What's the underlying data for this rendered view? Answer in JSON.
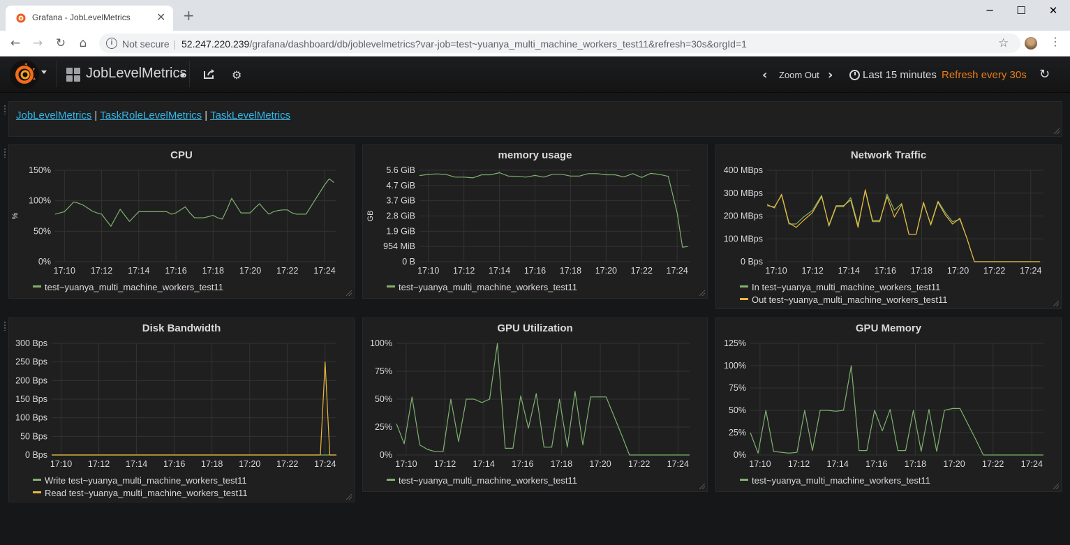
{
  "browser": {
    "tab_title": "Grafana - JobLevelMetrics",
    "tab_close": "✕",
    "new_tab": "+",
    "window": {
      "minimize": "─",
      "maximize": "☐",
      "close": "✕"
    },
    "back": "←",
    "forward": "→",
    "reload": "↻",
    "home": "⌂",
    "security_label": "Not secure",
    "url_host": "52.247.220.239",
    "url_rest": "/grafana/dashboard/db/joblevelmetrics?var-job=test~yuanya_multi_machine_workers_test11&refresh=30s&orgId=1",
    "star": "☆",
    "menu": "⋮"
  },
  "navbar": {
    "dashboard_title": "JobLevelMetrics",
    "share_icon": "share-icon",
    "settings_icon": "gear-icon",
    "zoom_out": "Zoom Out",
    "zoom_prev": "‹",
    "zoom_next": "›",
    "time_range": "Last 15 minutes",
    "refresh": "Refresh every 30s",
    "refresh_icon": "↻",
    "accent_color": "#eb7b18"
  },
  "links": {
    "items": [
      "JobLevelMetrics",
      "TaskRoleLevelMetrics",
      "TaskLevelMetrics"
    ],
    "separator": "|"
  },
  "panels": [
    {
      "title": "CPU",
      "legend": [
        {
          "label": "test~yuanya_multi_machine_workers_test11",
          "color": "#7eb26d"
        }
      ]
    },
    {
      "title": "memory usage",
      "legend": [
        {
          "label": "test~yuanya_multi_machine_workers_test11",
          "color": "#7eb26d"
        }
      ]
    },
    {
      "title": "Network Traffic",
      "legend": [
        {
          "label": "In test~yuanya_multi_machine_workers_test11",
          "color": "#7eb26d"
        },
        {
          "label": "Out test~yuanya_multi_machine_workers_test11",
          "color": "#eab839"
        }
      ]
    },
    {
      "title": "Disk Bandwidth",
      "legend": [
        {
          "label": "Write test~yuanya_multi_machine_workers_test11",
          "color": "#7eb26d"
        },
        {
          "label": "Read test~yuanya_multi_machine_workers_test11",
          "color": "#eab839"
        }
      ]
    },
    {
      "title": "GPU Utilization",
      "legend": [
        {
          "label": "test~yuanya_multi_machine_workers_test11",
          "color": "#7eb26d"
        }
      ]
    },
    {
      "title": "GPU Memory",
      "legend": [
        {
          "label": "test~yuanya_multi_machine_workers_test11",
          "color": "#7eb26d"
        }
      ]
    }
  ],
  "chart_data": [
    {
      "type": "line",
      "title": "CPU",
      "ylabel": "%",
      "x_ticks": [
        "17:10",
        "17:12",
        "17:14",
        "17:16",
        "17:18",
        "17:20",
        "17:22",
        "17:24"
      ],
      "y_ticks": [
        "0%",
        "50%",
        "100%",
        "150%"
      ],
      "xlim": [
        9.5,
        24.6
      ],
      "ylim": [
        0,
        150
      ],
      "grid": true,
      "legend": "bottom",
      "series": [
        {
          "color": "#7eb26d",
          "x": [
            9.5,
            9.75,
            10,
            10.25,
            10.5,
            10.75,
            11,
            11.25,
            11.5,
            11.75,
            12,
            12.25,
            12.5,
            12.75,
            13,
            13.25,
            13.5,
            13.75,
            14,
            14.25,
            14.5,
            14.75,
            15,
            15.25,
            15.5,
            15.75,
            16,
            16.25,
            16.5,
            16.75,
            17,
            17.25,
            17.5,
            17.75,
            18,
            18.25,
            18.5,
            18.75,
            19,
            19.25,
            19.5,
            19.75,
            20,
            20.25,
            20.5,
            20.75,
            21,
            21.25,
            21.5,
            21.75,
            22,
            22.25,
            22.5,
            22.75,
            23,
            23.25,
            23.5,
            23.75,
            24,
            24.25,
            24.5
          ],
          "y": [
            78,
            80,
            82,
            90,
            98,
            96,
            93,
            88,
            83,
            80,
            78,
            68,
            58,
            72,
            86,
            76,
            66,
            74,
            82,
            82,
            82,
            82,
            82,
            82,
            82,
            78,
            80,
            85,
            90,
            80,
            72,
            72,
            72,
            74,
            76,
            72,
            70,
            86,
            104,
            92,
            80,
            80,
            80,
            88,
            95,
            86,
            78,
            82,
            84,
            85,
            85,
            80,
            78,
            78,
            78,
            90,
            102,
            114,
            126,
            136,
            130
          ]
        }
      ]
    },
    {
      "type": "line",
      "title": "memory usage",
      "ylabel": "GB",
      "x_ticks": [
        "17:10",
        "17:12",
        "17:14",
        "17:16",
        "17:18",
        "17:20",
        "17:22",
        "17:24"
      ],
      "y_ticks": [
        "0 B",
        "954 MiB",
        "1.9 GiB",
        "2.8 GiB",
        "3.7 GiB",
        "4.7 GiB",
        "5.6 GiB"
      ],
      "xlim": [
        9.5,
        24.7
      ],
      "ylim": [
        0,
        6
      ],
      "grid": true,
      "legend": "bottom",
      "series": [
        {
          "color": "#7eb26d",
          "x": [
            9.5,
            10,
            10.5,
            11,
            11.5,
            12,
            12.5,
            13,
            13.5,
            14,
            14.5,
            15,
            15.5,
            16,
            16.5,
            17,
            17.5,
            18,
            18.5,
            19,
            19.5,
            20,
            20.5,
            21,
            21.5,
            22,
            22.5,
            23,
            23.5,
            24,
            24.3,
            24.6
          ],
          "y": [
            5.65,
            5.73,
            5.76,
            5.72,
            5.55,
            5.55,
            5.5,
            5.7,
            5.7,
            5.84,
            5.62,
            5.6,
            5.55,
            5.66,
            5.55,
            5.74,
            5.74,
            5.62,
            5.62,
            5.78,
            5.78,
            5.7,
            5.7,
            5.56,
            5.78,
            5.53,
            5.8,
            5.73,
            5.6,
            3.2,
            0.95,
            1.0
          ]
        }
      ]
    },
    {
      "type": "line",
      "title": "Network Traffic",
      "x_ticks": [
        "17:10",
        "17:12",
        "17:14",
        "17:16",
        "17:18",
        "17:20",
        "17:22",
        "17:24"
      ],
      "y_ticks": [
        "0 Bps",
        "100 MBps",
        "200 MBps",
        "300 MBps",
        "400 MBps"
      ],
      "xlim": [
        9.5,
        24.7
      ],
      "ylim": [
        0,
        400
      ],
      "grid": true,
      "legend": "bottom",
      "series": [
        {
          "name": "In test~yuanya_multi_machine_workers_test11",
          "color": "#7eb26d",
          "x": [
            9.5,
            9.9,
            10.3,
            10.7,
            11.1,
            11.5,
            12.0,
            12.5,
            12.9,
            13.3,
            13.7,
            14.1,
            14.5,
            14.9,
            15.3,
            15.7,
            16.1,
            16.5,
            16.9,
            17.3,
            17.7,
            18.1,
            18.5,
            18.9,
            19.3,
            19.7,
            20.1,
            20.5,
            20.9,
            21.3,
            21.7,
            22.1,
            22.5,
            22.9,
            23.3,
            23.7,
            24.1,
            24.5
          ],
          "y": [
            245,
            240,
            290,
            165,
            165,
            195,
            225,
            290,
            155,
            240,
            240,
            280,
            160,
            310,
            175,
            175,
            295,
            225,
            255,
            120,
            120,
            255,
            165,
            265,
            215,
            175,
            185,
            100,
            0,
            0,
            0,
            0,
            0,
            0,
            0,
            0,
            0,
            0
          ]
        },
        {
          "name": "Out test~yuanya_multi_machine_workers_test11",
          "color": "#eab839",
          "x": [
            9.5,
            9.9,
            10.3,
            10.7,
            11.1,
            11.5,
            12.0,
            12.5,
            12.9,
            13.3,
            13.7,
            14.1,
            14.5,
            14.9,
            15.3,
            15.7,
            16.1,
            16.5,
            16.9,
            17.3,
            17.7,
            18.1,
            18.5,
            18.9,
            19.3,
            19.7,
            20.1,
            20.5,
            20.9,
            21.3,
            21.7,
            22.1,
            22.5,
            22.9,
            23.3,
            23.7,
            24.1,
            24.5
          ],
          "y": [
            250,
            235,
            295,
            170,
            150,
            180,
            215,
            285,
            160,
            245,
            245,
            270,
            150,
            315,
            180,
            180,
            285,
            195,
            250,
            120,
            120,
            260,
            160,
            260,
            205,
            165,
            190,
            100,
            0,
            0,
            0,
            0,
            0,
            0,
            0,
            0,
            0,
            0
          ]
        }
      ]
    },
    {
      "type": "line",
      "title": "Disk Bandwidth",
      "x_ticks": [
        "17:10",
        "17:12",
        "17:14",
        "17:16",
        "17:18",
        "17:20",
        "17:22",
        "17:24"
      ],
      "y_ticks": [
        "0 Bps",
        "50 Bps",
        "100 Bps",
        "150 Bps",
        "200 Bps",
        "250 Bps",
        "300 Bps"
      ],
      "xlim": [
        9.5,
        24.6
      ],
      "ylim": [
        0,
        300
      ],
      "grid": true,
      "legend": "bottom",
      "series": [
        {
          "name": "Write test~yuanya_multi_machine_workers_test11",
          "color": "#7eb26d",
          "x": [
            9.5,
            24.6
          ],
          "y": [
            0,
            0
          ]
        },
        {
          "name": "Read test~yuanya_multi_machine_workers_test11",
          "color": "#eab839",
          "x": [
            9.5,
            23.5,
            23.75,
            24.0,
            24.25,
            24.6
          ],
          "y": [
            0,
            0,
            0,
            250,
            0,
            0
          ]
        }
      ]
    },
    {
      "type": "line",
      "title": "GPU Utilization",
      "x_ticks": [
        "17:10",
        "17:12",
        "17:14",
        "17:16",
        "17:18",
        "17:20",
        "17:22",
        "17:24"
      ],
      "y_ticks": [
        "0%",
        "25%",
        "50%",
        "75%",
        "100%"
      ],
      "xlim": [
        9.5,
        24.6
      ],
      "ylim": [
        0,
        100
      ],
      "grid": true,
      "legend": "bottom",
      "series": [
        {
          "color": "#7eb26d",
          "x": [
            9.5,
            9.9,
            10.3,
            10.7,
            11.1,
            11.5,
            11.9,
            12.3,
            12.7,
            13.1,
            13.5,
            13.9,
            14.3,
            14.7,
            15.1,
            15.5,
            15.9,
            16.3,
            16.7,
            17.1,
            17.5,
            17.9,
            18.3,
            18.7,
            19.1,
            19.5,
            19.9,
            20.3,
            20.7,
            21.1,
            21.5,
            21.9,
            22.3,
            22.7,
            23.1,
            23.5,
            23.9,
            24.3,
            24.6
          ],
          "y": [
            28,
            10,
            52,
            9,
            5,
            3,
            3,
            50,
            12,
            50,
            50,
            47,
            50,
            100,
            6,
            6,
            53,
            24,
            55,
            7,
            7,
            50,
            7,
            57,
            9,
            52,
            52,
            52,
            35,
            18,
            0,
            0,
            0,
            0,
            0,
            0,
            0,
            0,
            0
          ]
        }
      ]
    },
    {
      "type": "line",
      "title": "GPU Memory",
      "x_ticks": [
        "17:10",
        "17:12",
        "17:14",
        "17:16",
        "17:18",
        "17:20",
        "17:22",
        "17:24"
      ],
      "y_ticks": [
        "0%",
        "25%",
        "50%",
        "75%",
        "100%",
        "125%"
      ],
      "xlim": [
        9.5,
        24.6
      ],
      "ylim": [
        0,
        125
      ],
      "grid": true,
      "legend": "bottom",
      "series": [
        {
          "color": "#7eb26d",
          "x": [
            9.5,
            9.9,
            10.3,
            10.7,
            11.1,
            11.5,
            11.9,
            12.3,
            12.7,
            13.1,
            13.5,
            13.9,
            14.3,
            14.7,
            15.1,
            15.5,
            15.9,
            16.3,
            16.7,
            17.1,
            17.5,
            17.9,
            18.3,
            18.7,
            19.1,
            19.5,
            19.9,
            20.3,
            20.7,
            21.1,
            21.5,
            21.9,
            22.3,
            22.7,
            23.1,
            23.5,
            23.9,
            24.3,
            24.6
          ],
          "y": [
            25,
            2,
            50,
            4,
            3,
            2,
            3,
            50,
            5,
            50,
            50,
            49,
            50,
            100,
            5,
            5,
            50,
            27,
            51,
            5,
            5,
            50,
            4,
            51,
            4,
            50,
            52,
            52,
            35,
            18,
            0,
            0,
            0,
            0,
            0,
            0,
            0,
            0,
            0
          ]
        }
      ]
    }
  ]
}
